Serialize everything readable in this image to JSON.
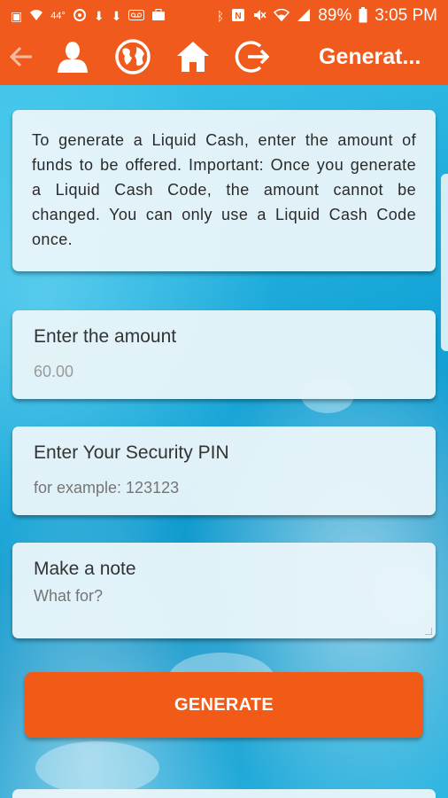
{
  "status_bar": {
    "temperature": "44°",
    "battery_percent": "89%",
    "time": "3:05 PM",
    "icons_left": [
      "image-icon",
      "wifi-icon",
      "temperature-label",
      "sync-icon",
      "download-icon",
      "download-icon",
      "voicemail-icon",
      "briefcase-icon"
    ],
    "icons_right": [
      "bluetooth-icon",
      "nfc-icon",
      "mute-icon",
      "wifi-signal-icon",
      "cell-signal-icon",
      "battery-icon"
    ]
  },
  "app_bar": {
    "title": "Generat...",
    "icons": [
      "back-arrow-icon",
      "profile-icon",
      "globe-icon",
      "home-icon",
      "logout-icon"
    ]
  },
  "info": {
    "text": "To generate a Liquid Cash, enter the amount of funds to be offered. Important: Once you generate a Liquid Cash Code, the amount cannot be changed. You can only use a Liquid Cash Code once."
  },
  "amount": {
    "label": "Enter the amount",
    "value": "60.00"
  },
  "pin": {
    "label": "Enter Your Security PIN",
    "placeholder": "for example: 123123"
  },
  "note": {
    "label": "Make a note",
    "placeholder": "What for?"
  },
  "generate_button": {
    "label": "GENERATE"
  },
  "colors": {
    "primary": "#f05a1c",
    "card": "#e8f5f9",
    "background": "#1aa8d8"
  }
}
